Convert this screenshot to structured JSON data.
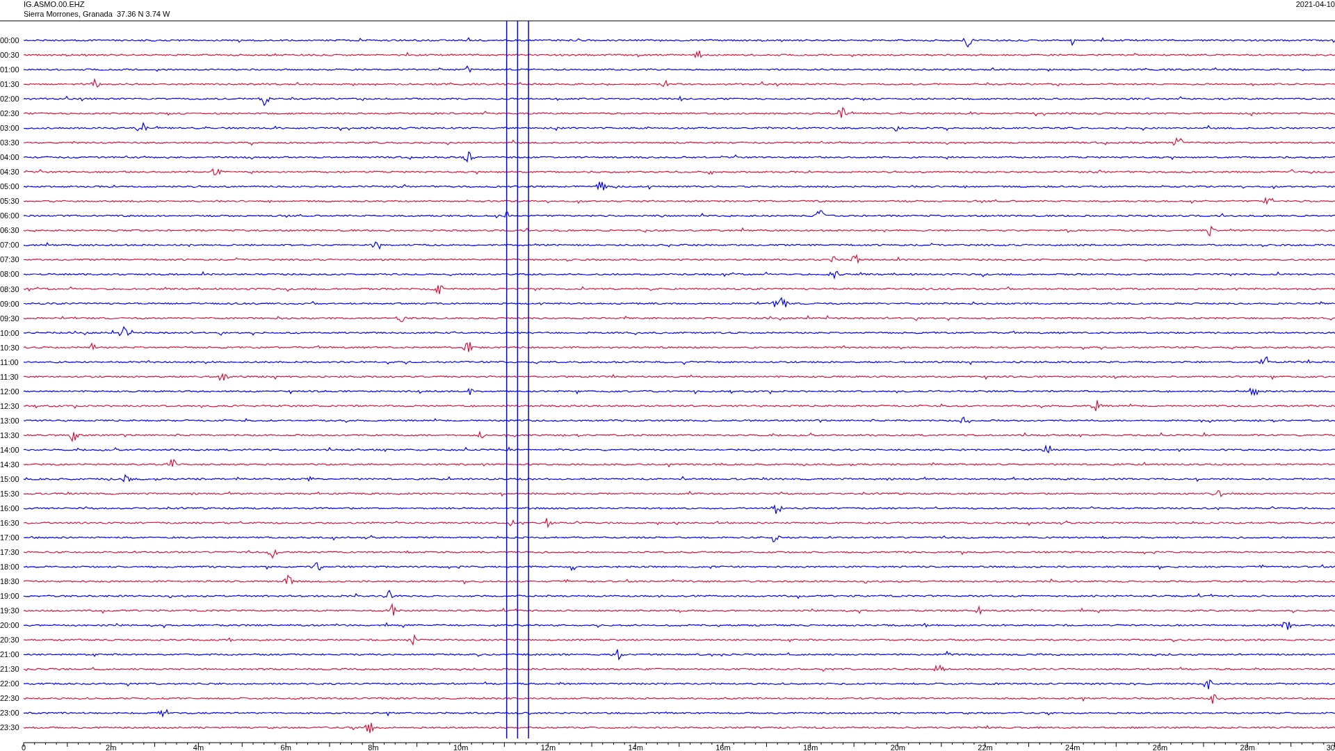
{
  "header": {
    "station": "IG.ASMO.00.EHZ",
    "location": "Sierra Morrones, Granada  37.36 N 3.74 W",
    "date": "2021-04-10"
  },
  "traces": [
    {
      "time": "00:00",
      "color": "#0000ff"
    },
    {
      "time": "00:30",
      "color": "#dc143c"
    },
    {
      "time": "01:00",
      "color": "#0000ff"
    },
    {
      "time": "01:30",
      "color": "#dc143c"
    },
    {
      "time": "02:00",
      "color": "#0000ff"
    },
    {
      "time": "02:30",
      "color": "#dc143c"
    },
    {
      "time": "03:00",
      "color": "#0000ff"
    },
    {
      "time": "03:30",
      "color": "#dc143c"
    },
    {
      "time": "04:00",
      "color": "#0000ff"
    },
    {
      "time": "04:30",
      "color": "#dc143c"
    },
    {
      "time": "05:00",
      "color": "#0000ff"
    },
    {
      "time": "05:30",
      "color": "#dc143c"
    },
    {
      "time": "06:00",
      "color": "#0000ff"
    },
    {
      "time": "06:30",
      "color": "#dc143c"
    },
    {
      "time": "07:00",
      "color": "#0000ff"
    },
    {
      "time": "07:30",
      "color": "#dc143c"
    },
    {
      "time": "08:00",
      "color": "#0000ff"
    },
    {
      "time": "08:30",
      "color": "#dc143c"
    },
    {
      "time": "09:00",
      "color": "#0000ff"
    },
    {
      "time": "09:30",
      "color": "#dc143c"
    },
    {
      "time": "10:00",
      "color": "#0000ff"
    },
    {
      "time": "10:30",
      "color": "#dc143c"
    },
    {
      "time": "11:00",
      "color": "#0000ff"
    },
    {
      "time": "11:30",
      "color": "#dc143c"
    },
    {
      "time": "12:00",
      "color": "#0000ff"
    },
    {
      "time": "12:30",
      "color": "#dc143c"
    },
    {
      "time": "13:00",
      "color": "#0000ff"
    },
    {
      "time": "13:30",
      "color": "#dc143c"
    },
    {
      "time": "14:00",
      "color": "#0000ff"
    },
    {
      "time": "14:30",
      "color": "#dc143c"
    },
    {
      "time": "15:00",
      "color": "#0000ff"
    },
    {
      "time": "15:30",
      "color": "#dc143c"
    },
    {
      "time": "16:00",
      "color": "#0000ff"
    },
    {
      "time": "16:30",
      "color": "#dc143c"
    },
    {
      "time": "17:00",
      "color": "#0000ff"
    },
    {
      "time": "17:30",
      "color": "#dc143c"
    },
    {
      "time": "18:00",
      "color": "#0000ff"
    },
    {
      "time": "18:30",
      "color": "#dc143c"
    },
    {
      "time": "19:00",
      "color": "#0000ff"
    },
    {
      "time": "19:30",
      "color": "#dc143c"
    },
    {
      "time": "20:00",
      "color": "#0000ff"
    },
    {
      "time": "20:30",
      "color": "#dc143c"
    },
    {
      "time": "21:00",
      "color": "#0000ff"
    },
    {
      "time": "21:30",
      "color": "#dc143c"
    },
    {
      "time": "22:00",
      "color": "#0000ff"
    },
    {
      "time": "22:30",
      "color": "#dc143c"
    },
    {
      "time": "23:00",
      "color": "#0000ff"
    },
    {
      "time": "23:30",
      "color": "#dc143c"
    }
  ],
  "x_axis": {
    "ticks": [
      "0",
      "2m",
      "4m",
      "6m",
      "8m",
      "10m",
      "12m",
      "14m",
      "16m",
      "18m",
      "20m",
      "22m",
      "24m",
      "26m",
      "28m",
      "30"
    ]
  }
}
